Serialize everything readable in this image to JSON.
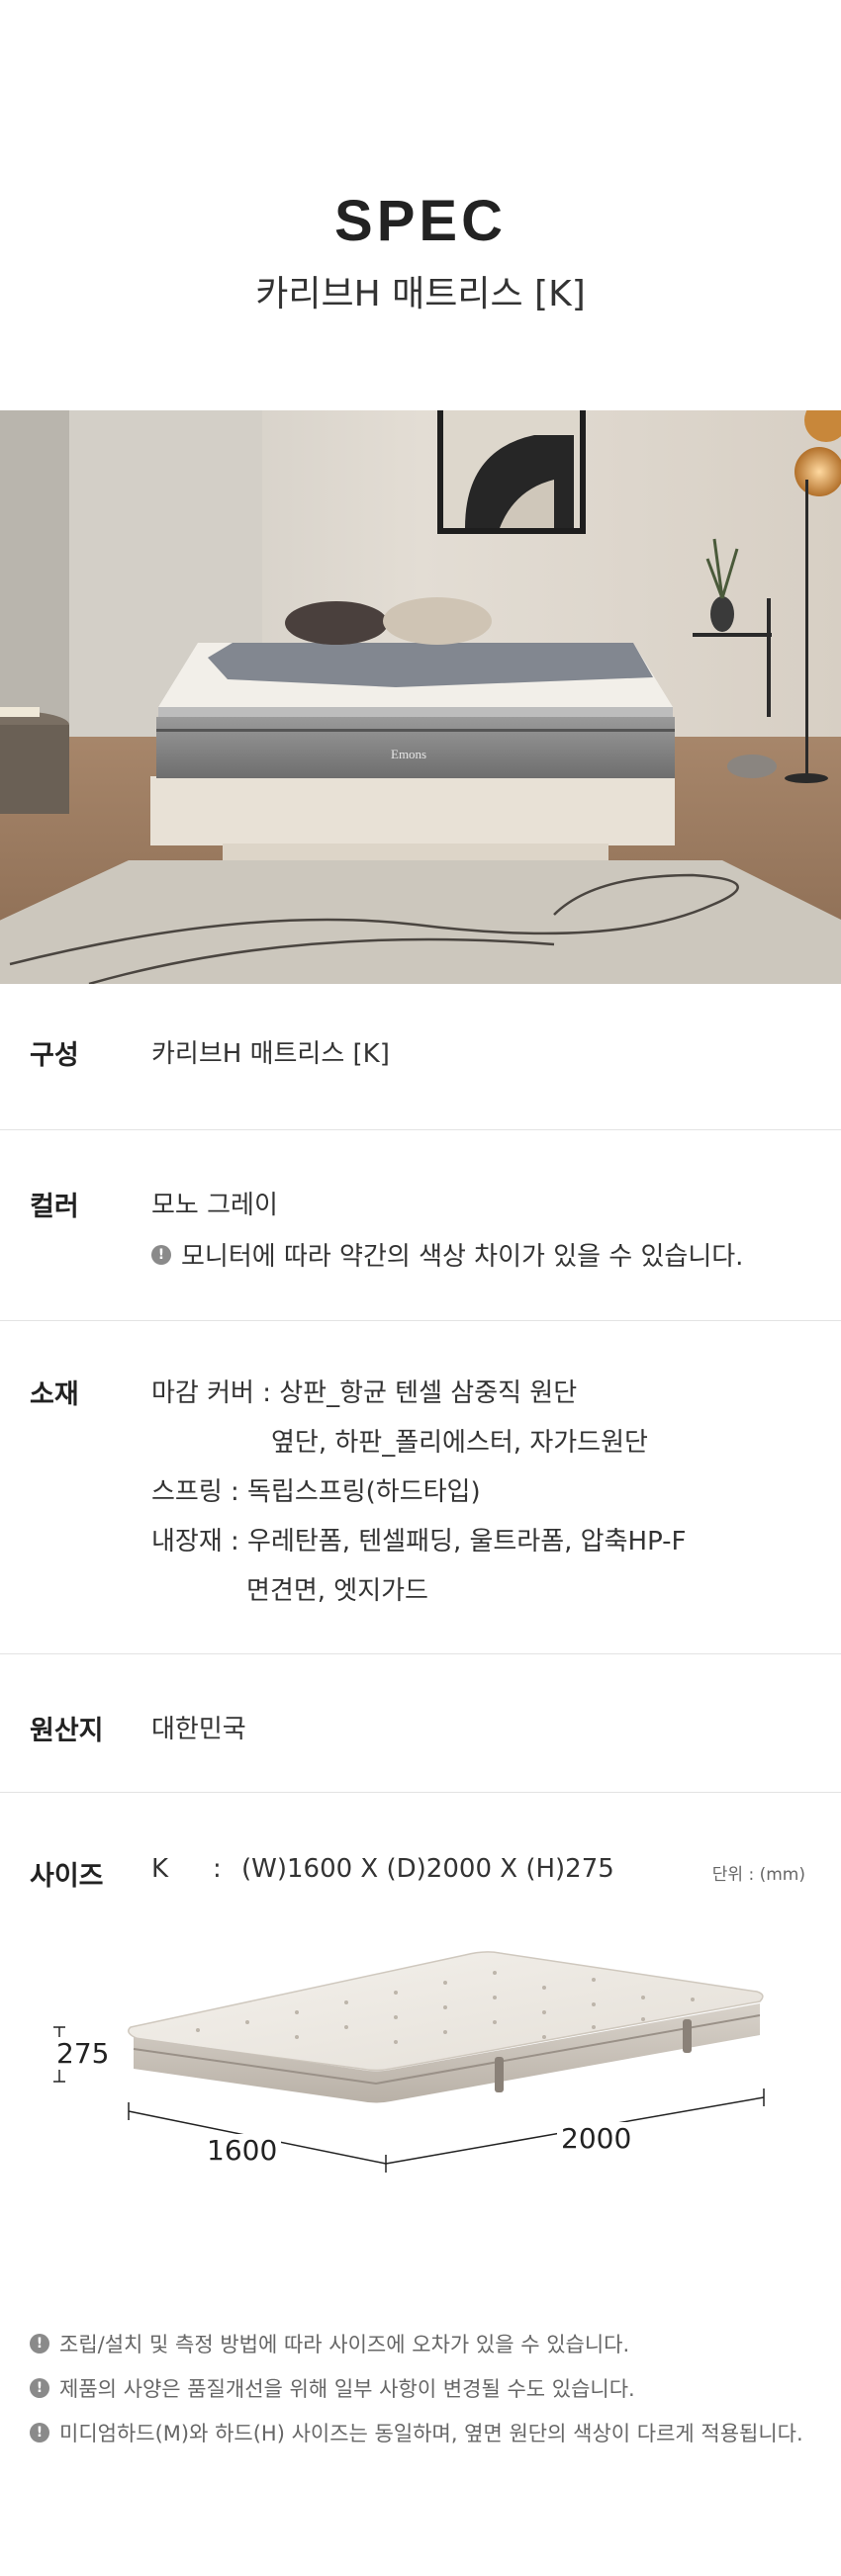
{
  "header": {
    "title": "SPEC",
    "subtitle": "카리브H 매트리스 [K]"
  },
  "scene": {
    "mattress_brand": "Emons"
  },
  "spec": {
    "composition": {
      "label": "구성",
      "value": "카리브H 매트리스 [K]"
    },
    "color": {
      "label": "컬러",
      "value": "모노 그레이",
      "note": "모니터에 따라 약간의 색상 차이가 있을 수 있습니다."
    },
    "material": {
      "label": "소재",
      "lines": [
        "마감 커버 : 상판_항균 텐셀 삼중직 원단",
        "옆단, 하판_폴리에스터, 자가드원단",
        "스프링 : 독립스프링(하드타입)",
        "내장재 : 우레탄폼, 텐셀패딩, 울트라폼, 압축HP-F",
        "면견면, 엣지가드"
      ]
    },
    "origin": {
      "label": "원산지",
      "value": "대한민국"
    },
    "size": {
      "label": "사이즈",
      "code": "K",
      "separator": ":",
      "value": "(W)1600 X (D)2000 X (H)275",
      "unit": "단위 : (mm)",
      "dimensions": {
        "height": "275",
        "width": "1600",
        "depth": "2000"
      }
    }
  },
  "footnotes": [
    "조립/설치 및 측정 방법에 따라 사이즈에 오차가 있을 수 있습니다.",
    "제품의 사양은 품질개선을 위해 일부 사항이 변경될 수도 있습니다.",
    "미디엄하드(M)와 하드(H) 사이즈는 동일하며, 옆면 원단의 색상이 다르게 적용됩니다."
  ],
  "colors": {
    "text": "#222222",
    "muted": "#6b6b6b",
    "divider": "#e3e3e3",
    "wall": "#d9d3ca",
    "mattress": "#e8e4de"
  },
  "icons": {
    "note": "exclamation-circle-icon"
  }
}
